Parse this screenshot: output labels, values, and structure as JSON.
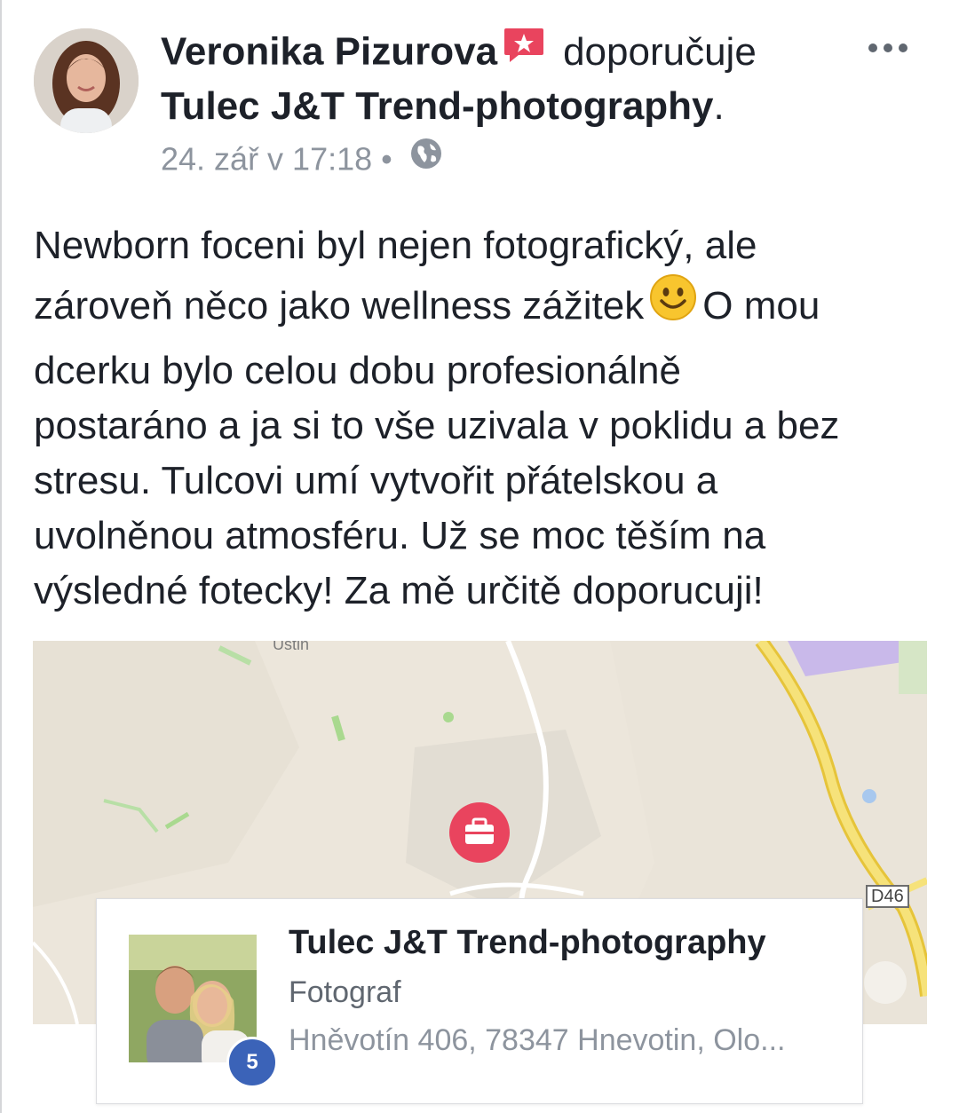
{
  "post": {
    "author": "Veronika Pizurova",
    "verb": "doporučuje",
    "page_name": "Tulec J&T Trend-photography",
    "period": ".",
    "timestamp": "24. zář v 17:18",
    "separator": "•",
    "privacy_icon": "globe-icon",
    "more_icon": "more-dots-icon",
    "text_part1": "Newborn foceni byl nejen fotografický, ale\nzároveň něco jako wellness zážitek",
    "emoji": "smiley-emoji",
    "text_part2": "O mou\ndcerku bylo celou dobu profesionálně\npostaráno a ja si to vše uzivala v poklidu a bez\nstresu. Tulcovi umí vytvořit přátelskou a\nuvolněnou atmosféru. Už se moc těším na\nvýsledné fotecky! Za mě určitě doporucuji!"
  },
  "map": {
    "place_label": "Ustin",
    "road_label": "D46",
    "pin_icon": "briefcase-pin-icon"
  },
  "card": {
    "title": "Tulec J&T Trend-photography",
    "category": "Fotograf",
    "address": "Hněvotín 406, 78347 Hnevotin, Olo...",
    "badge_count": "5"
  },
  "colors": {
    "text": "#1d2129",
    "meta": "#8d949e",
    "pin": "#e9445e",
    "badge": "#3b63b8",
    "highway": "#f2dc4c",
    "map_bg": "#ece6db"
  }
}
